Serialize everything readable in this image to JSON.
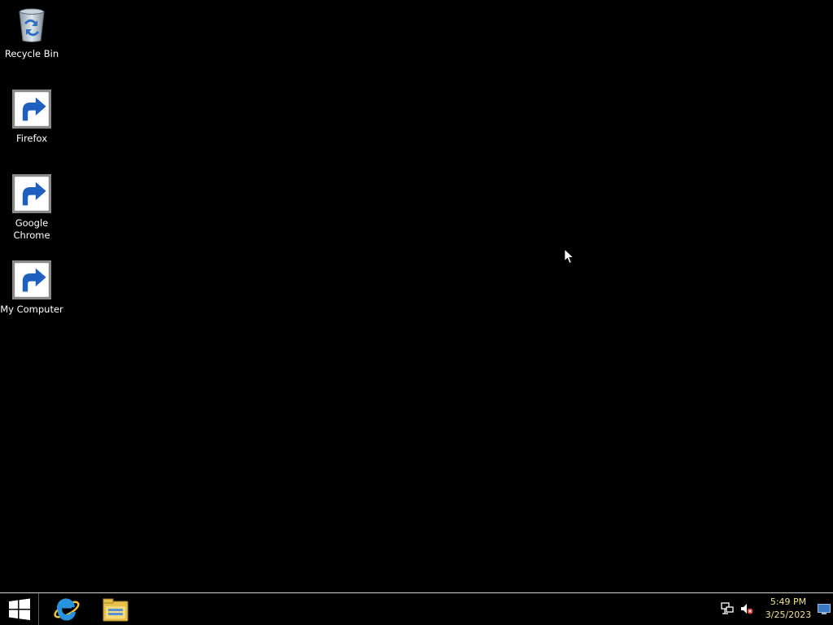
{
  "desktop": {
    "background_color": "#000000",
    "icons": [
      {
        "label": "Recycle Bin",
        "icon": "recycle-bin-icon"
      },
      {
        "label": "Firefox",
        "icon": "firefox-icon"
      },
      {
        "label": "Google\nChrome",
        "icon": "chrome-icon"
      },
      {
        "label": "My Computer",
        "icon": "computer-icon"
      }
    ]
  },
  "taskbar": {
    "pinned": [
      {
        "icon": "internet-explorer-icon"
      },
      {
        "icon": "file-explorer-icon"
      }
    ],
    "tray": {
      "icons": [
        "network-icon",
        "volume-muted-icon"
      ],
      "time": "5:49 PM",
      "date": "3/25/2023",
      "clock_color": "#f5e28a"
    }
  }
}
